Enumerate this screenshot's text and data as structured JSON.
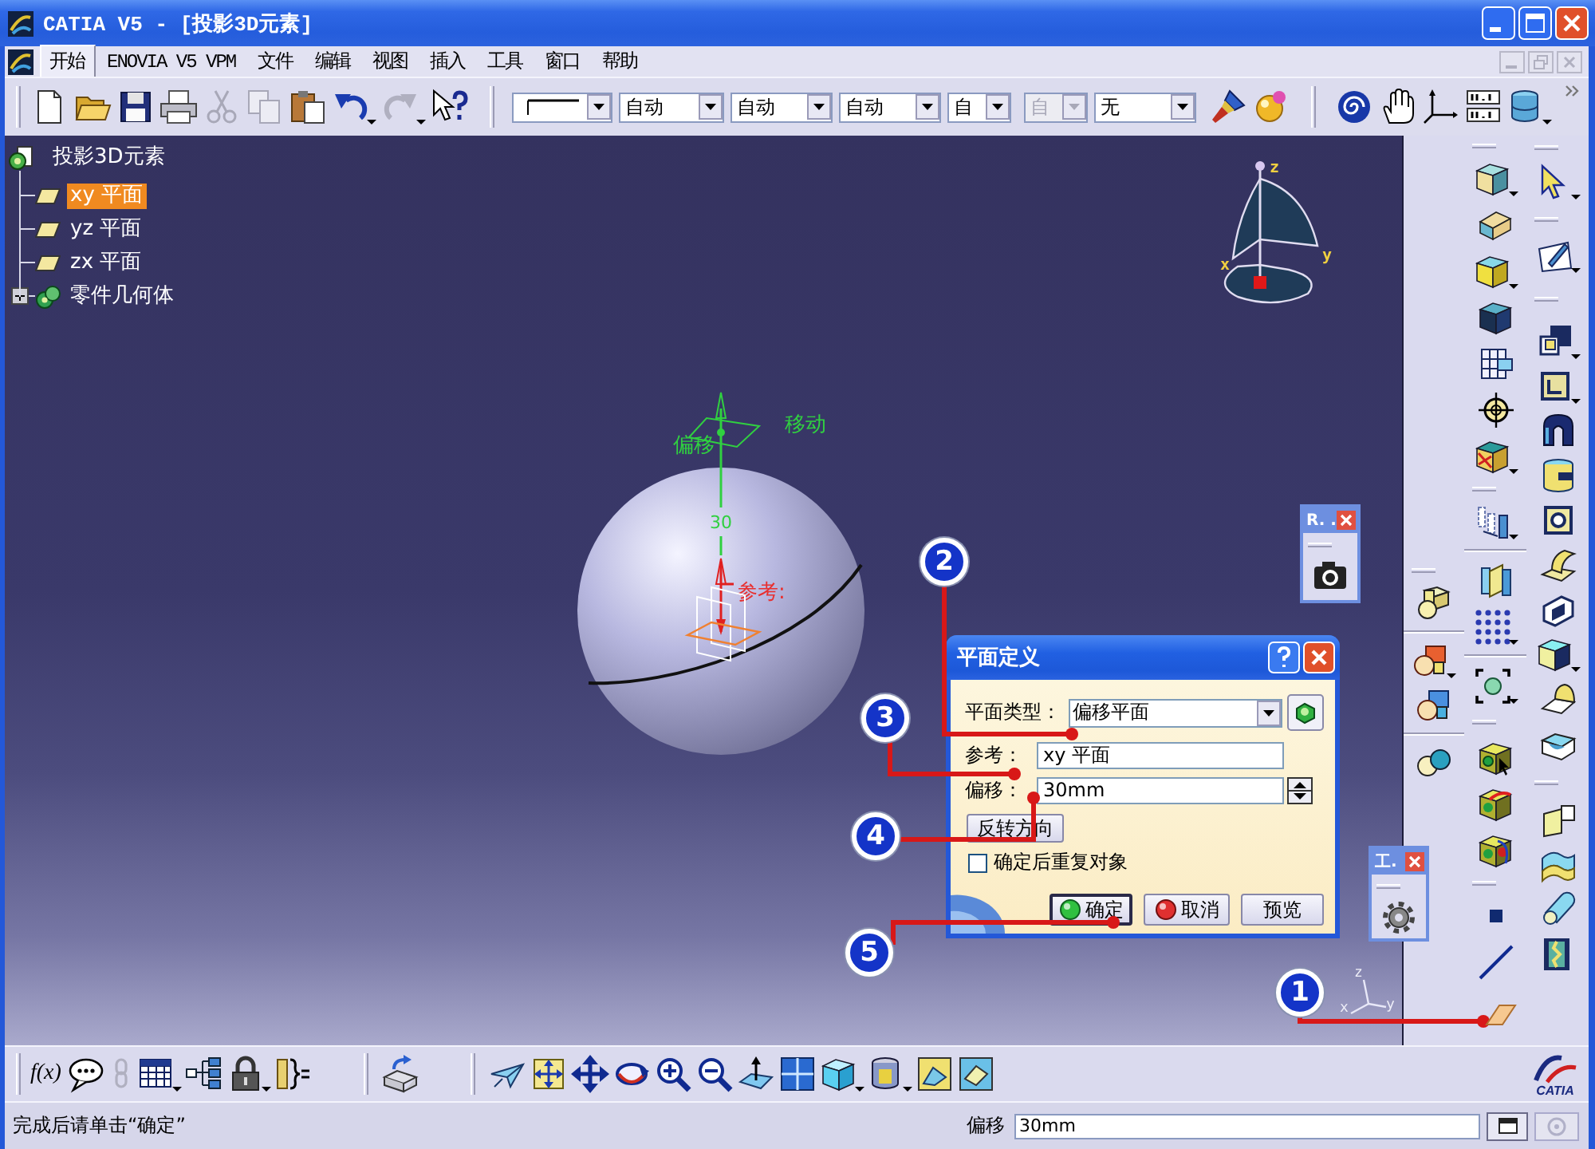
{
  "window": {
    "title": "CATIA V5 - [投影3D元素]"
  },
  "menu": [
    {
      "label": "开始",
      "selected": true
    },
    {
      "label": "ENOVIA V5 VPM",
      "selected": false
    },
    {
      "label": "文件",
      "selected": false
    },
    {
      "label": "编辑",
      "selected": false
    },
    {
      "label": "视图",
      "selected": false
    },
    {
      "label": "插入",
      "selected": false
    },
    {
      "label": "工具",
      "selected": false
    },
    {
      "label": "窗口",
      "selected": false
    },
    {
      "label": "帮助",
      "selected": false
    }
  ],
  "toolbar": {
    "dropdowns": [
      {
        "kind": "line",
        "disabled": false
      },
      {
        "kind": "text",
        "value": "自动",
        "disabled": false
      },
      {
        "kind": "text",
        "value": "自动",
        "disabled": false
      },
      {
        "kind": "text",
        "value": "自动",
        "disabled": false
      },
      {
        "kind": "text",
        "value": "自",
        "disabled": false
      },
      {
        "kind": "text",
        "value": "自",
        "disabled": true
      },
      {
        "kind": "text",
        "value": "无",
        "disabled": false
      }
    ]
  },
  "tree": {
    "label": "投影3D元素",
    "children": [
      {
        "kind": "plane",
        "label": "xy 平面",
        "selected": true
      },
      {
        "kind": "plane",
        "label": "yz 平面",
        "selected": false
      },
      {
        "kind": "plane",
        "label": "zx 平面",
        "selected": false
      },
      {
        "kind": "body",
        "label": "零件几何体",
        "selected": false,
        "expanded": false
      }
    ]
  },
  "viewport": {
    "compass": {
      "axis_labels": [
        "z",
        "y",
        "x"
      ]
    },
    "manipulator": {
      "offset_label": "偏移",
      "move_label": "移动",
      "distance": "30",
      "reference_label": "参考:"
    },
    "axis_triad": {
      "axis_labels": [
        "z",
        "x",
        "y"
      ]
    }
  },
  "floating_toolbars": [
    {
      "title": "R. ."
    },
    {
      "title": "工."
    }
  ],
  "dialog": {
    "title": "平面定义",
    "fields": [
      {
        "kind": "combo",
        "label": "平面类型：",
        "value": "偏移平面"
      },
      {
        "kind": "text",
        "label": "参考：",
        "value": "xy 平面"
      },
      {
        "kind": "spin",
        "label": "偏移：",
        "value": "30mm"
      }
    ],
    "flip_button": "反转方向",
    "repeat": {
      "label": "确定后重复对象",
      "checked": false
    },
    "buttons": [
      {
        "kind": "ok",
        "label": "确定"
      },
      {
        "kind": "cancel",
        "label": "取消"
      },
      {
        "kind": "preview",
        "label": "预览"
      }
    ]
  },
  "callouts": [
    {
      "number": "1"
    },
    {
      "number": "2"
    },
    {
      "number": "3"
    },
    {
      "number": "4"
    },
    {
      "number": "5"
    }
  ],
  "bottom_toolbar": {
    "formula": "f(x)",
    "logo_text": "CATIA"
  },
  "status_bar": {
    "message": "完成后请单击“确定”",
    "field_label": "偏移",
    "field_value": "30mm"
  }
}
